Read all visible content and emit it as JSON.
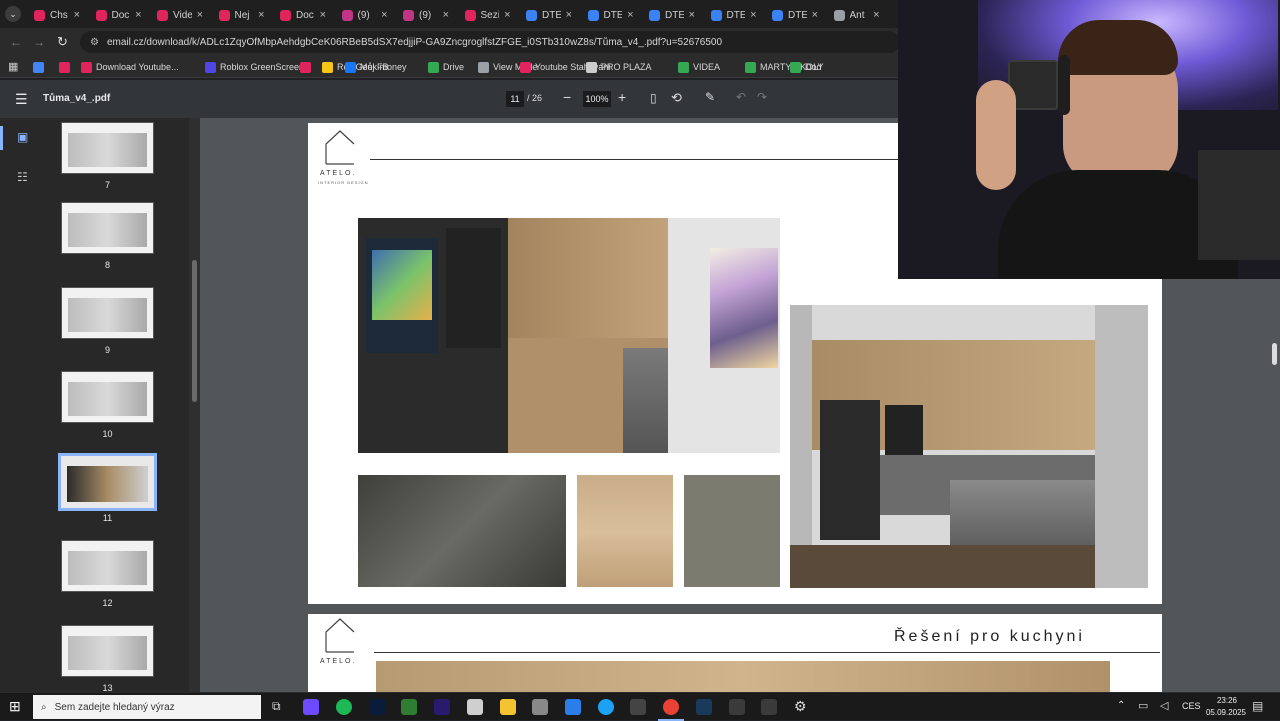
{
  "browser": {
    "tabs": [
      {
        "label": "Chs",
        "color": "#e0245e"
      },
      {
        "label": "Doc",
        "color": "#e0245e"
      },
      {
        "label": "Vide",
        "color": "#e0245e"
      },
      {
        "label": "Nej",
        "color": "#e0245e"
      },
      {
        "label": "Doc",
        "color": "#e0245e"
      },
      {
        "label": "(9)",
        "color": "#c13584"
      },
      {
        "label": "(9)",
        "color": "#c13584"
      },
      {
        "label": "Sezi",
        "color": "#e0245e"
      },
      {
        "label": "DTE",
        "color": "#3b82f6"
      },
      {
        "label": "DTE",
        "color": "#3b82f6"
      },
      {
        "label": "DTE",
        "color": "#3b82f6"
      },
      {
        "label": "DTE",
        "color": "#3b82f6"
      },
      {
        "label": "DTE",
        "color": "#3b82f6"
      },
      {
        "label": "Ant",
        "color": "#9aa0a6"
      }
    ],
    "url": "email.cz/download/k/ADLc1ZqyOfMbpAehdgbCeK06RBeB5dSX7edjjiP-GA9ZncgroglfstZFGE_i0STb310wZ8s/Tůma_v4_.pdf?u=52676500",
    "bookmarks": [
      {
        "label": "",
        "color": "#4285f4"
      },
      {
        "label": "",
        "color": "#e0245e"
      },
      {
        "label": "Download Youtube...",
        "color": "#e0245e"
      },
      {
        "label": "Roblox GreenScreen",
        "color": "#4f46e5"
      },
      {
        "label": "",
        "color": "#e0245e"
      },
      {
        "label": "RealGeek money",
        "color": "#f5c518"
      },
      {
        "label": "Můj FB",
        "color": "#1877f2"
      },
      {
        "label": "Drive",
        "color": "#34a853"
      },
      {
        "label": "View Mode",
        "color": "#9aa0a6"
      },
      {
        "label": "Youtube Stahování",
        "color": "#e0245e"
      },
      {
        "label": "PRO PLAZA",
        "color": "#cccccc"
      },
      {
        "label": "VIDEA",
        "color": "#34a853"
      },
      {
        "label": "MARTY UKOLY",
        "color": "#34a853"
      },
      {
        "label": "Dod",
        "color": "#34a853"
      }
    ]
  },
  "pdf": {
    "title": "Tůma_v4_.pdf",
    "page_current": "11",
    "page_sep": "/",
    "page_total": "26",
    "zoom": "100%"
  },
  "thumbnails": [
    {
      "label": "7",
      "selected": false
    },
    {
      "label": "8",
      "selected": false
    },
    {
      "label": "9",
      "selected": false
    },
    {
      "label": "10",
      "selected": false
    },
    {
      "label": "11",
      "selected": true
    },
    {
      "label": "12",
      "selected": false
    },
    {
      "label": "13",
      "selected": false
    }
  ],
  "document": {
    "brand": "ATELO.",
    "brand_sub": "INTERIOR DESIGN",
    "page2_heading": "Řešení pro kuchyni"
  },
  "taskbar": {
    "search_placeholder": "Sem zadejte hledaný výraz",
    "language": "CES",
    "time": "23:26",
    "date": "05.09.2025"
  },
  "colors": {
    "pdf_toolbar": "#323639",
    "viewer_bg": "#525659",
    "selection": "#8ab4f8"
  }
}
